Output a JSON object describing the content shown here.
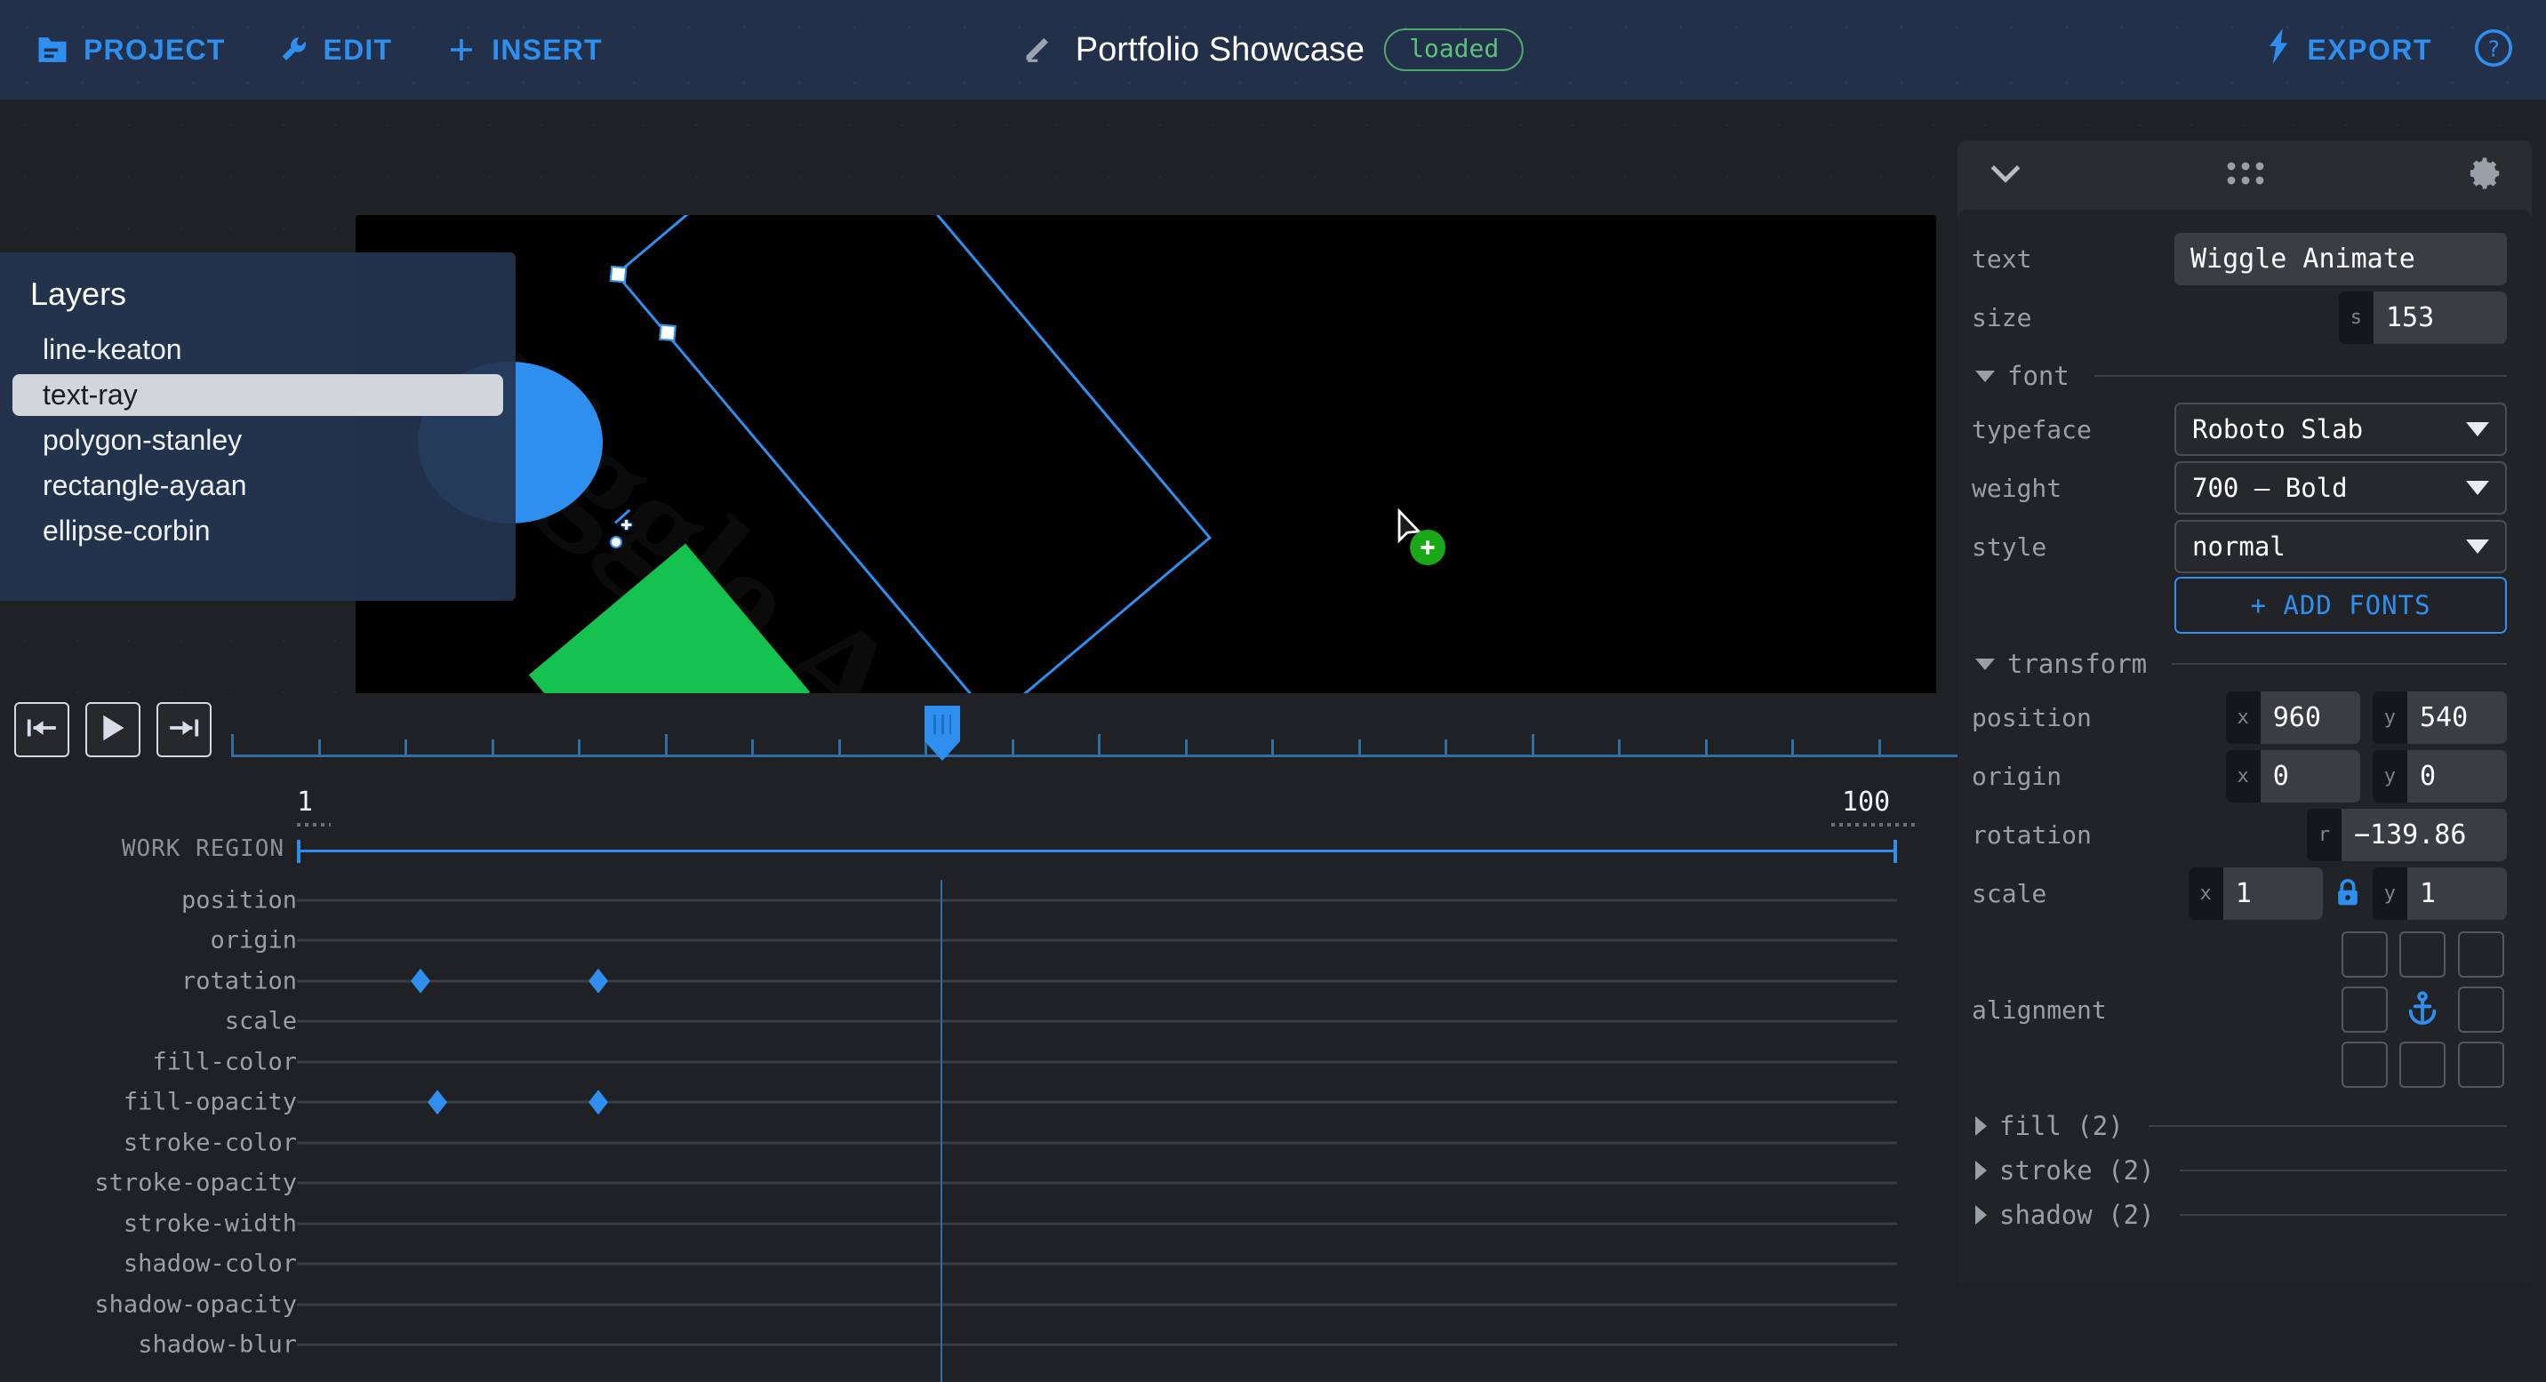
{
  "topbar": {
    "menu": [
      {
        "label": "PROJECT",
        "icon": "folder-icon"
      },
      {
        "label": "EDIT",
        "icon": "wrench-icon"
      },
      {
        "label": "INSERT",
        "icon": "plus-icon"
      }
    ],
    "title": "Portfolio Showcase",
    "title_icon": "pencil-icon",
    "status_badge": "loaded",
    "export_label": "EXPORT",
    "export_icon": "bolt-icon",
    "help_icon": "help-circle-icon",
    "accent": "#2f8fef",
    "badge_color": "#5fbf7c"
  },
  "layers": {
    "title": "Layers",
    "items": [
      {
        "label": "line-keaton",
        "selected": false
      },
      {
        "label": "text-ray",
        "selected": true
      },
      {
        "label": "polygon-stanley",
        "selected": false
      },
      {
        "label": "rectangle-ayaan",
        "selected": false
      },
      {
        "label": "ellipse-corbin",
        "selected": false
      }
    ]
  },
  "canvas": {
    "ghost_text": "Wiggle Animate",
    "shapes": [
      {
        "name": "ellipse",
        "color": "#2f8fef"
      },
      {
        "name": "polygon",
        "color": "#15c24f"
      }
    ],
    "selection_color": "#2f8fef",
    "cursor": {
      "badge": "plus",
      "badge_color": "#1aa81a"
    }
  },
  "timeline": {
    "transport": [
      {
        "name": "jump-to-start-button",
        "icon": "skip-back-icon"
      },
      {
        "name": "play-button",
        "icon": "play-icon"
      },
      {
        "name": "jump-to-end-button",
        "icon": "skip-forward-icon"
      }
    ],
    "work_region_label": "WORK REGION",
    "work_region_start": "1",
    "work_region_end": "100",
    "tracks": [
      {
        "label": "position",
        "keyframes": []
      },
      {
        "label": "origin",
        "keyframes": []
      },
      {
        "label": "rotation",
        "keyframes": [
          473,
          673
        ]
      },
      {
        "label": "scale",
        "keyframes": []
      },
      {
        "label": "fill-color",
        "keyframes": []
      },
      {
        "label": "fill-opacity",
        "keyframes": [
          492,
          673
        ]
      },
      {
        "label": "stroke-color",
        "keyframes": []
      },
      {
        "label": "stroke-opacity",
        "keyframes": []
      },
      {
        "label": "stroke-width",
        "keyframes": []
      },
      {
        "label": "shadow-color",
        "keyframes": []
      },
      {
        "label": "shadow-opacity",
        "keyframes": []
      },
      {
        "label": "shadow-blur",
        "keyframes": []
      }
    ]
  },
  "properties": {
    "header": {
      "collapse_icon": "chevron-down-icon",
      "grip_icon": "grid-dots-icon",
      "settings_icon": "gear-icon"
    },
    "text": {
      "label": "text",
      "value": "Wiggle Animate"
    },
    "size": {
      "label": "size",
      "tag": "s",
      "value": "153"
    },
    "font": {
      "title": "font",
      "typeface": {
        "label": "typeface",
        "value": "Roboto Slab"
      },
      "weight": {
        "label": "weight",
        "value": "700 — Bold"
      },
      "style": {
        "label": "style",
        "value": "normal"
      },
      "add_fonts": "+ ADD FONTS"
    },
    "transform": {
      "title": "transform",
      "position": {
        "label": "position",
        "x_tag": "x",
        "x": "960",
        "y_tag": "y",
        "y": "540"
      },
      "origin": {
        "label": "origin",
        "x_tag": "x",
        "x": "0",
        "y_tag": "y",
        "y": "0"
      },
      "rotation": {
        "label": "rotation",
        "tag": "r",
        "value": "−139.86"
      },
      "scale": {
        "label": "scale",
        "x_tag": "x",
        "x": "1",
        "y_tag": "y",
        "y": "1",
        "lock_icon": "lock-icon"
      },
      "alignment": {
        "label": "alignment",
        "active_icon": "anchor-icon",
        "active_index": 4
      }
    },
    "sections": [
      {
        "label": "fill (2)",
        "expanded": false
      },
      {
        "label": "stroke (2)",
        "expanded": false
      },
      {
        "label": "shadow (2)",
        "expanded": false
      }
    ]
  }
}
